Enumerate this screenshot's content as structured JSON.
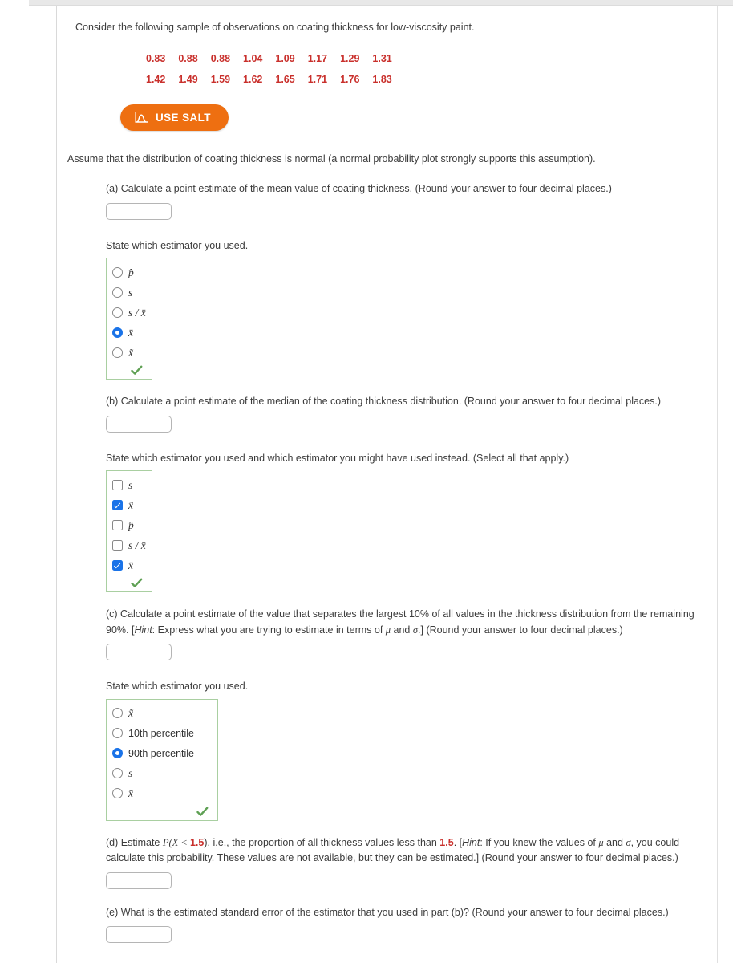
{
  "problem": {
    "intro": "Consider the following sample of observations on coating thickness for low-viscosity paint.",
    "assumption": "Assume that the distribution of coating thickness is normal (a normal probability plot strongly supports this assumption).",
    "data_rows": [
      [
        "0.83",
        "0.88",
        "0.88",
        "1.04",
        "1.09",
        "1.17",
        "1.29",
        "1.31"
      ],
      [
        "1.42",
        "1.49",
        "1.59",
        "1.62",
        "1.65",
        "1.71",
        "1.76",
        "1.83"
      ]
    ],
    "data_color": "#c9302c"
  },
  "salt_button": {
    "label": "USE SALT",
    "icon": "normal-curve-icon",
    "color": "#ee6f11"
  },
  "parts": {
    "a": {
      "question": "(a) Calculate a point estimate of the mean value of coating thickness. (Round your answer to four decimal places.)",
      "answer_value": "",
      "state_label": "State which estimator you used.",
      "options": [
        {
          "label": "p̂",
          "selected": false
        },
        {
          "label": "s",
          "selected": false
        },
        {
          "label": "s / x̄",
          "selected": false
        },
        {
          "label": "x̄",
          "selected": true
        },
        {
          "label": "x̃",
          "selected": false
        }
      ],
      "graded": true
    },
    "b": {
      "question": "(b) Calculate a point estimate of the median of the coating thickness distribution. (Round your answer to four decimal places.)",
      "answer_value": "",
      "state_label": "State which estimator you used and which estimator you might have used instead. (Select all that apply.)",
      "options": [
        {
          "label": "s",
          "checked": false
        },
        {
          "label": "x̃",
          "checked": true
        },
        {
          "label": "p̂",
          "checked": false
        },
        {
          "label": "s / x̄",
          "checked": false
        },
        {
          "label": "x̄",
          "checked": true
        }
      ],
      "graded": true
    },
    "c": {
      "question_pre": "(c) Calculate a point estimate of the value that separates the largest 10% of all values in the thickness distribution from the remaining 90%. [",
      "hint_word": "Hint",
      "question_mid": ": Express what you are trying to estimate in terms of ",
      "mu": "μ",
      "and": " and ",
      "sigma": "σ",
      "question_post": ".] (Round your answer to four decimal places.)",
      "answer_value": "",
      "state_label": "State which estimator you used.",
      "options": [
        {
          "label": "x̃",
          "selected": false,
          "math": true
        },
        {
          "label": "10th percentile",
          "selected": false,
          "math": false
        },
        {
          "label": "90th percentile",
          "selected": true,
          "math": false
        },
        {
          "label": "s",
          "selected": false,
          "math": true
        },
        {
          "label": "x̄",
          "selected": false,
          "math": true
        }
      ],
      "graded": true
    },
    "d": {
      "seg_1": "(d) Estimate ",
      "prob_open": "P(X < ",
      "value_1": "1.5",
      "prob_close": ")",
      "seg_2": ", i.e., the proportion of all thickness values less than ",
      "value_2": "1.5",
      "seg_3": ". [",
      "hint_word": "Hint",
      "seg_4": ": If you knew the values of ",
      "mu": "μ",
      "and": " and ",
      "sigma": "σ",
      "seg_5": ", you could calculate this probability. These values are not available, but they can be estimated.] (Round your answer to four decimal places.)",
      "answer_value": ""
    },
    "e": {
      "question": "(e) What is the estimated standard error of the estimator that you used in part (b)? (Round your answer to four decimal places.)",
      "answer_value": ""
    }
  },
  "colors": {
    "accent_orange": "#ee6f11",
    "data_red": "#c9302c",
    "selected_blue": "#1a73e8",
    "correct_green": "#5fa054",
    "group_border_green": "#a9cfa1"
  }
}
